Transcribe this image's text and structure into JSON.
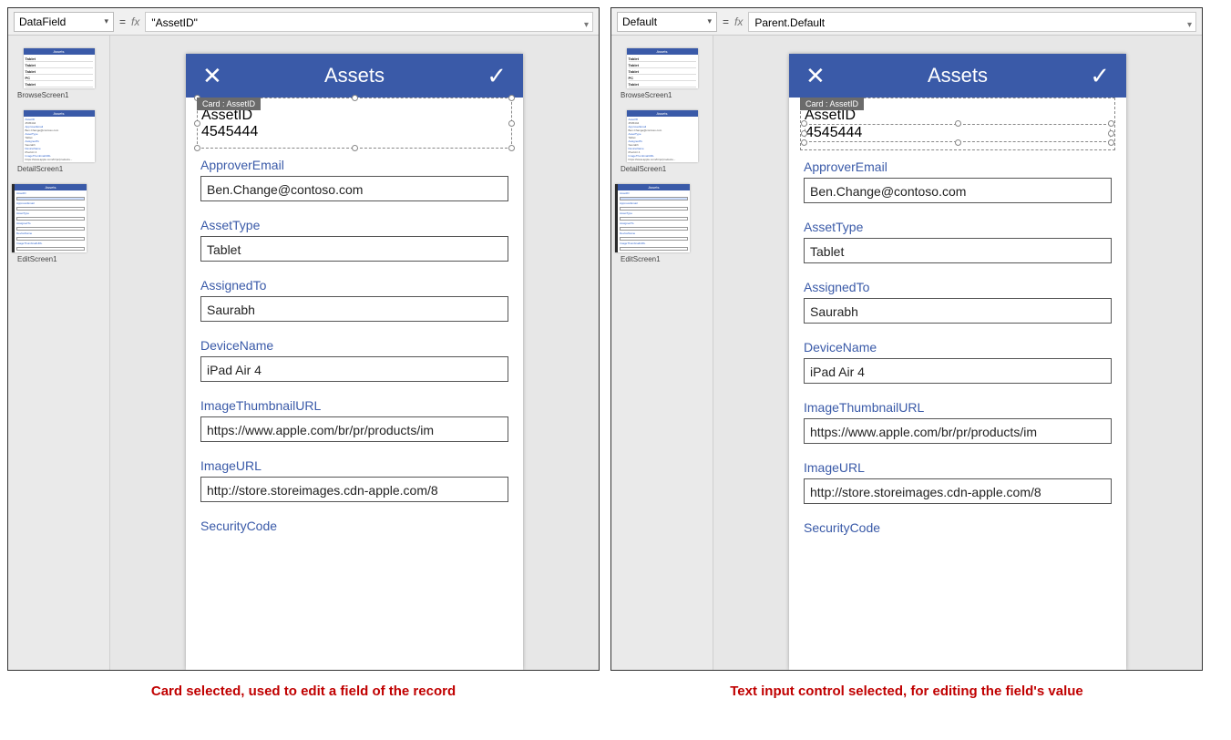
{
  "left": {
    "property_name": "DataField",
    "formula": "\"AssetID\"",
    "thumbs": {
      "browse": "BrowseScreen1",
      "detail": "DetailScreen1",
      "edit": "EditScreen1"
    },
    "card_tag": "Card : AssetID",
    "caption": "Card selected, used to edit a field of the record"
  },
  "right": {
    "property_name": "Default",
    "formula": "Parent.Default",
    "thumbs": {
      "browse": "BrowseScreen1",
      "detail": "DetailScreen1",
      "edit": "EditScreen1"
    },
    "card_tag": "Card : AssetID",
    "caption": "Text input control selected, for editing the field's value"
  },
  "app": {
    "title": "Assets",
    "thumb_header": "Assets",
    "thumb_items": [
      "Tablet",
      "Tablet",
      "Tablet",
      "PC",
      "Tablet"
    ],
    "fields": [
      {
        "label": "AssetID",
        "value": "4545444"
      },
      {
        "label": "ApproverEmail",
        "value": "Ben.Change@contoso.com"
      },
      {
        "label": "AssetType",
        "value": "Tablet"
      },
      {
        "label": "AssignedTo",
        "value": "Saurabh"
      },
      {
        "label": "DeviceName",
        "value": "iPad Air 4"
      },
      {
        "label": "ImageThumbnailURL",
        "value": "https://www.apple.com/br/pr/products/im"
      },
      {
        "label": "ImageURL",
        "value": "http://store.storeimages.cdn-apple.com/8"
      },
      {
        "label": "SecurityCode",
        "value": ""
      }
    ]
  }
}
